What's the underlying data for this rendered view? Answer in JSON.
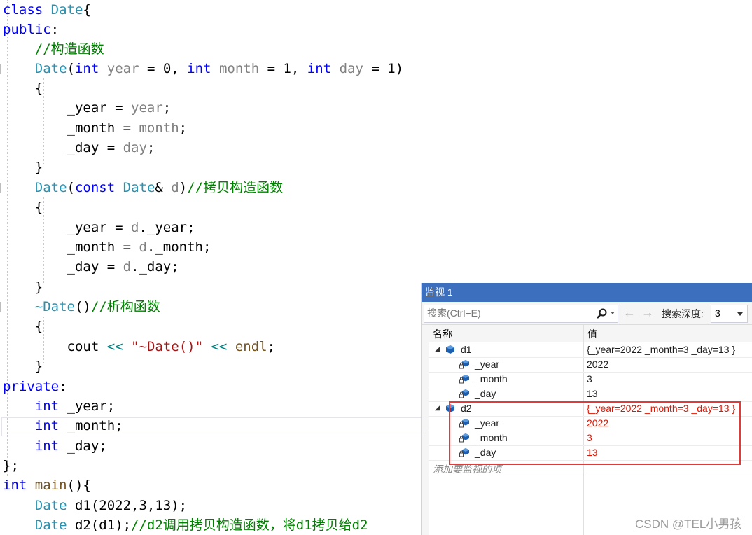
{
  "code": {
    "lines": [
      [
        {
          "c": "kw",
          "t": "class"
        },
        {
          "c": "txt",
          "t": " "
        },
        {
          "c": "type",
          "t": "Date"
        },
        {
          "c": "txt",
          "t": "{"
        }
      ],
      [
        {
          "c": "kw",
          "t": "public"
        },
        {
          "c": "txt",
          "t": ":"
        }
      ],
      [
        {
          "c": "txt",
          "t": "    "
        },
        {
          "c": "com",
          "t": "//构造函数"
        }
      ],
      [
        {
          "c": "txt",
          "t": "    "
        },
        {
          "c": "type",
          "t": "Date"
        },
        {
          "c": "txt",
          "t": "("
        },
        {
          "c": "kw",
          "t": "int"
        },
        {
          "c": "txt",
          "t": " "
        },
        {
          "c": "param",
          "t": "year"
        },
        {
          "c": "txt",
          "t": " = 0, "
        },
        {
          "c": "kw",
          "t": "int"
        },
        {
          "c": "txt",
          "t": " "
        },
        {
          "c": "param",
          "t": "month"
        },
        {
          "c": "txt",
          "t": " = 1, "
        },
        {
          "c": "kw",
          "t": "int"
        },
        {
          "c": "txt",
          "t": " "
        },
        {
          "c": "param",
          "t": "day"
        },
        {
          "c": "txt",
          "t": " = 1)"
        }
      ],
      [
        {
          "c": "txt",
          "t": "    {"
        }
      ],
      [
        {
          "c": "txt",
          "t": "        _year = "
        },
        {
          "c": "param",
          "t": "year"
        },
        {
          "c": "txt",
          "t": ";"
        }
      ],
      [
        {
          "c": "txt",
          "t": "        _month = "
        },
        {
          "c": "param",
          "t": "month"
        },
        {
          "c": "txt",
          "t": ";"
        }
      ],
      [
        {
          "c": "txt",
          "t": "        _day = "
        },
        {
          "c": "param",
          "t": "day"
        },
        {
          "c": "txt",
          "t": ";"
        }
      ],
      [
        {
          "c": "txt",
          "t": "    }"
        }
      ],
      [
        {
          "c": "txt",
          "t": "    "
        },
        {
          "c": "type",
          "t": "Date"
        },
        {
          "c": "txt",
          "t": "("
        },
        {
          "c": "kw",
          "t": "const"
        },
        {
          "c": "txt",
          "t": " "
        },
        {
          "c": "type",
          "t": "Date"
        },
        {
          "c": "txt",
          "t": "& "
        },
        {
          "c": "param",
          "t": "d"
        },
        {
          "c": "txt",
          "t": ")"
        },
        {
          "c": "com",
          "t": "//拷贝构造函数"
        }
      ],
      [
        {
          "c": "txt",
          "t": "    {"
        }
      ],
      [
        {
          "c": "txt",
          "t": "        _year = "
        },
        {
          "c": "param",
          "t": "d"
        },
        {
          "c": "txt",
          "t": "._year;"
        }
      ],
      [
        {
          "c": "txt",
          "t": "        _month = "
        },
        {
          "c": "param",
          "t": "d"
        },
        {
          "c": "txt",
          "t": "._month;"
        }
      ],
      [
        {
          "c": "txt",
          "t": "        _day = "
        },
        {
          "c": "param",
          "t": "d"
        },
        {
          "c": "txt",
          "t": "._day;"
        }
      ],
      [
        {
          "c": "txt",
          "t": "    }"
        }
      ],
      [
        {
          "c": "txt",
          "t": "    "
        },
        {
          "c": "type",
          "t": "~Date"
        },
        {
          "c": "txt",
          "t": "()"
        },
        {
          "c": "com",
          "t": "//析构函数"
        }
      ],
      [
        {
          "c": "txt",
          "t": "    {"
        }
      ],
      [
        {
          "c": "txt",
          "t": "        cout "
        },
        {
          "c": "op",
          "t": "<<"
        },
        {
          "c": "txt",
          "t": " "
        },
        {
          "c": "str",
          "t": "\"~Date()\""
        },
        {
          "c": "txt",
          "t": " "
        },
        {
          "c": "op",
          "t": "<<"
        },
        {
          "c": "txt",
          "t": " "
        },
        {
          "c": "fn",
          "t": "endl"
        },
        {
          "c": "txt",
          "t": ";"
        }
      ],
      [
        {
          "c": "txt",
          "t": "    }"
        }
      ],
      [
        {
          "c": "kw",
          "t": "private"
        },
        {
          "c": "txt",
          "t": ":"
        }
      ],
      [
        {
          "c": "txt",
          "t": "    "
        },
        {
          "c": "kw",
          "t": "int"
        },
        {
          "c": "txt",
          "t": " _year;"
        }
      ],
      [
        {
          "c": "txt",
          "t": "    "
        },
        {
          "c": "kw",
          "t": "int"
        },
        {
          "c": "txt",
          "t": " _month;"
        }
      ],
      [
        {
          "c": "txt",
          "t": "    "
        },
        {
          "c": "kw",
          "t": "int"
        },
        {
          "c": "txt",
          "t": " _day;"
        }
      ],
      [
        {
          "c": "txt",
          "t": "};"
        }
      ],
      [
        {
          "c": "kw",
          "t": "int"
        },
        {
          "c": "txt",
          "t": " "
        },
        {
          "c": "fn",
          "t": "main"
        },
        {
          "c": "txt",
          "t": "(){"
        }
      ],
      [
        {
          "c": "txt",
          "t": "    "
        },
        {
          "c": "type",
          "t": "Date"
        },
        {
          "c": "txt",
          "t": " d1(2022,3,13);"
        }
      ],
      [
        {
          "c": "txt",
          "t": "    "
        },
        {
          "c": "type",
          "t": "Date"
        },
        {
          "c": "txt",
          "t": " d2(d1);"
        },
        {
          "c": "com",
          "t": "//d2调用拷贝构造函数，将d1拷贝给d2"
        }
      ]
    ]
  },
  "watch": {
    "title": "监视 1",
    "search_placeholder": "搜索(Ctrl+E)",
    "depth_label": "搜索深度:",
    "depth_value": "3",
    "col_name": "名称",
    "col_value": "值",
    "rows": [
      {
        "name": "d1",
        "value": "{_year=2022 _month=3 _day=13 }",
        "level": 0,
        "expanded": true,
        "changed": false
      },
      {
        "name": "_year",
        "value": "2022",
        "level": 1,
        "changed": false
      },
      {
        "name": "_month",
        "value": "3",
        "level": 1,
        "changed": false
      },
      {
        "name": "_day",
        "value": "13",
        "level": 1,
        "changed": false
      },
      {
        "name": "d2",
        "value": "{_year=2022 _month=3 _day=13 }",
        "level": 0,
        "expanded": true,
        "changed": true
      },
      {
        "name": "_year",
        "value": "2022",
        "level": 1,
        "changed": true
      },
      {
        "name": "_month",
        "value": "3",
        "level": 1,
        "changed": true
      },
      {
        "name": "_day",
        "value": "13",
        "level": 1,
        "changed": true
      }
    ],
    "add_hint": "添加要监视的项"
  },
  "watermark": "CSDN @TEL小男孩",
  "colors": {
    "highlight_box": "#e03a3a",
    "changed_value": "#e51400",
    "title_bar": "#3c6fbd"
  }
}
